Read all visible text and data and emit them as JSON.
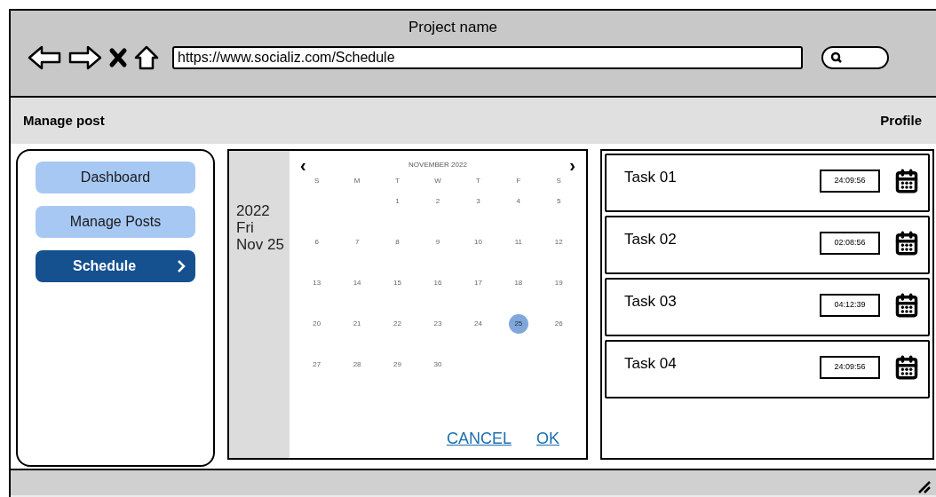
{
  "window": {
    "title": "Project name"
  },
  "browser": {
    "nav_buttons": [
      {
        "kind": "back"
      },
      {
        "kind": "forward"
      },
      {
        "kind": "stop"
      },
      {
        "kind": "home"
      }
    ],
    "url": "https://www.socializ.com/Schedule"
  },
  "header": {
    "title": "Manage post",
    "profile": "Profile"
  },
  "sidebar": {
    "items": [
      {
        "label": "Dashboard",
        "selected": false
      },
      {
        "label": "Manage Posts",
        "selected": false
      },
      {
        "label": "Schedule",
        "selected": true
      }
    ]
  },
  "date_picker": {
    "year": "2022",
    "weekday": "Fri",
    "date": "Nov 25",
    "month": "NOVEMBER 2022",
    "prev": "‹",
    "next": "›",
    "weekdays": [
      "S",
      "M",
      "T",
      "W",
      "T",
      "F",
      "S"
    ],
    "weeks": [
      [
        {
          "label": "1",
          "selected": false
        },
        {
          "label": "2",
          "selected": false
        },
        {
          "label": "3",
          "selected": false
        },
        {
          "label": "4",
          "selected": false
        },
        {
          "label": "5",
          "selected": false
        }
      ],
      [
        {
          "label": "6",
          "selected": false
        },
        {
          "label": "7",
          "selected": false
        },
        {
          "label": "8",
          "selected": false
        },
        {
          "label": "9",
          "selected": false
        },
        {
          "label": "10",
          "selected": false
        },
        {
          "label": "11",
          "selected": false
        },
        {
          "label": "12",
          "selected": false
        }
      ],
      [
        {
          "label": "13",
          "selected": false
        },
        {
          "label": "14",
          "selected": false
        },
        {
          "label": "15",
          "selected": false
        },
        {
          "label": "16",
          "selected": false
        },
        {
          "label": "17",
          "selected": false
        },
        {
          "label": "18",
          "selected": false
        },
        {
          "label": "19",
          "selected": false
        }
      ],
      [
        {
          "label": "20",
          "selected": false
        },
        {
          "label": "21",
          "selected": false
        },
        {
          "label": "22",
          "selected": false
        },
        {
          "label": "23",
          "selected": false
        },
        {
          "label": "24",
          "selected": false
        },
        {
          "label": "25",
          "selected": true
        },
        {
          "label": "26",
          "selected": false
        }
      ],
      [
        {
          "label": "27",
          "selected": false
        },
        {
          "label": "28",
          "selected": false
        },
        {
          "label": "29",
          "selected": false
        },
        {
          "label": "30",
          "selected": false
        }
      ]
    ],
    "buttons": [
      "CANCEL",
      "OK"
    ]
  },
  "tasks": [
    {
      "name": "Task 01",
      "time": "24:09:56"
    },
    {
      "name": "Task 02",
      "time": "02:08:56"
    },
    {
      "name": "Task 03",
      "time": "04:12:39"
    },
    {
      "name": "Task 04",
      "time": "24:09:56"
    }
  ]
}
